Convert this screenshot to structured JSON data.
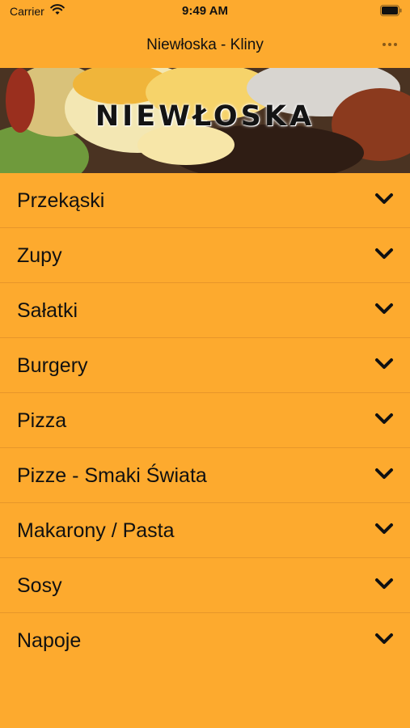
{
  "status_bar": {
    "carrier": "Carrier",
    "time": "9:49 AM",
    "wifi_icon": "wifi-icon",
    "battery_icon": "battery-full-icon"
  },
  "nav": {
    "title": "Niewłoska - Kliny",
    "more_icon": "more-horizontal-icon"
  },
  "hero": {
    "logo_text": "NIEWŁOSKA"
  },
  "menu": {
    "items": [
      {
        "label": "Przekąski"
      },
      {
        "label": "Zupy"
      },
      {
        "label": "Sałatki"
      },
      {
        "label": "Burgery"
      },
      {
        "label": "Pizza"
      },
      {
        "label": "Pizze - Smaki Świata"
      },
      {
        "label": "Makarony / Pasta"
      },
      {
        "label": "Sosy"
      },
      {
        "label": "Napoje"
      }
    ],
    "expand_icon": "chevron-down-icon"
  },
  "colors": {
    "background": "#fdaa2e",
    "divider": "#e7962a",
    "text": "#111111"
  }
}
